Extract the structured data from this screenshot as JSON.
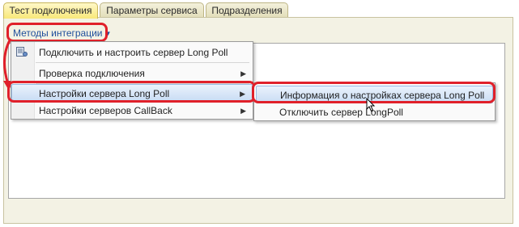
{
  "tabs": [
    {
      "label": "Тест подключения",
      "active": true
    },
    {
      "label": "Параметры сервиса",
      "active": false
    },
    {
      "label": "Подразделения",
      "active": false
    }
  ],
  "toolbar": {
    "methods_label": "Методы интеграции"
  },
  "menu": {
    "items": [
      {
        "label": "Подключить и настроить сервер Long Poll",
        "icon": "connect-server-icon"
      },
      {
        "label": "Проверка подключения",
        "submenu": true
      },
      {
        "label": "Настройки сервера Long Poll",
        "submenu": true,
        "selected": true
      },
      {
        "label": "Настройки серверов CallBack",
        "submenu": true
      }
    ]
  },
  "submenu": {
    "items": [
      {
        "label": "Информация о настройках сервера Long Poll",
        "selected": true
      },
      {
        "label": "Отключить сервер LongPoll"
      }
    ]
  },
  "colors": {
    "highlight": "#e0202a",
    "active_tab": "#f8e87a",
    "link": "#1f4f9c"
  }
}
